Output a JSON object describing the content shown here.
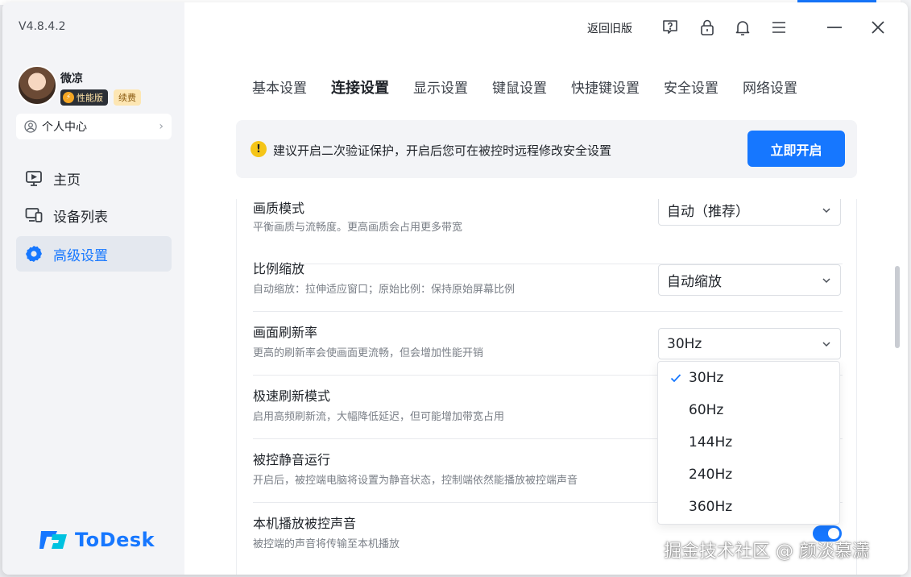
{
  "app": {
    "version": "V4.8.4.2",
    "back_to_old": "返回旧版"
  },
  "user": {
    "name": "微凉",
    "plan_badge": "性能版",
    "renew_badge": "续费",
    "profile_label": "个人中心"
  },
  "sidebar": {
    "items": [
      {
        "label": "主页",
        "active": false
      },
      {
        "label": "设备列表",
        "active": false
      },
      {
        "label": "高级设置",
        "active": true
      }
    ]
  },
  "logo": {
    "text": "ToDesk"
  },
  "tabs": [
    {
      "label": "基本设置",
      "active": false
    },
    {
      "label": "连接设置",
      "active": true
    },
    {
      "label": "显示设置",
      "active": false
    },
    {
      "label": "键鼠设置",
      "active": false
    },
    {
      "label": "快捷键设置",
      "active": false
    },
    {
      "label": "安全设置",
      "active": false
    },
    {
      "label": "网络设置",
      "active": false
    }
  ],
  "notice": {
    "message": "建议开启二次验证保护，开启后您可在被控时远程修改安全设置",
    "button": "立即开启"
  },
  "settings": [
    {
      "title": "画质模式",
      "desc": "平衡画质与流畅度。更高画质会占用更多带宽",
      "value": "自动（推荐）"
    },
    {
      "title": "比例缩放",
      "desc": "自动缩放：拉伸适应窗口；原始比例：保持原始屏幕比例",
      "value": "自动缩放"
    },
    {
      "title": "画面刷新率",
      "desc": "更高的刷新率会使画面更流畅，但会增加性能开销",
      "value": "30Hz"
    },
    {
      "title": "极速刷新模式",
      "desc": "启用高频刷新流，大幅降低延迟，但可能增加带宽占用"
    },
    {
      "title": "被控静音运行",
      "desc": "开启后，被控端电脑将设置为静音状态，控制端依然能播放被控端声音"
    },
    {
      "title": "本机播放被控声音",
      "desc": "被控端的声音将传输至本机播放",
      "toggle": true
    }
  ],
  "refresh_dropdown": {
    "options": [
      "30Hz",
      "60Hz",
      "144Hz",
      "240Hz",
      "360Hz"
    ],
    "selected": "30Hz"
  },
  "watermark": "掘金技术社区 @ 颜淡慕潇",
  "colors": {
    "accent": "#1677ff",
    "sidebar_bg": "#f3f4f7",
    "warning": "#f5c518"
  }
}
